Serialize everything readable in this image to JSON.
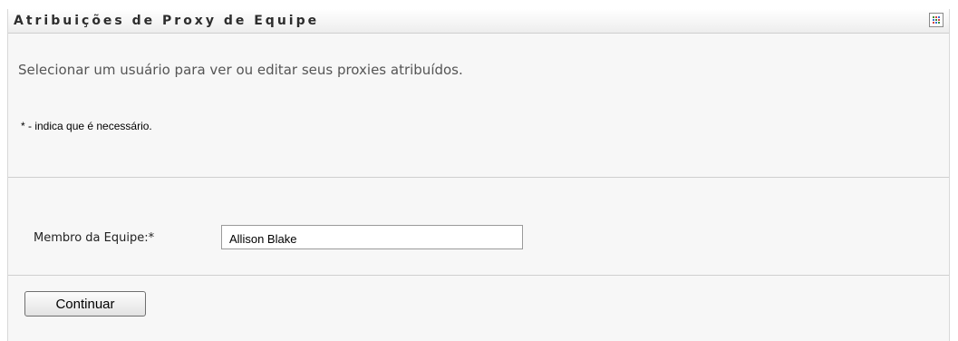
{
  "portlet": {
    "title": "Atribuições de Proxy de Equipe",
    "menu_icon": "grid-menu-icon",
    "description": "Selecionar um usuário para ver ou editar seus proxies atribuídos.",
    "required_note": "* - indica que é necessário."
  },
  "form": {
    "team_member_label": "Membro da Equipe:*",
    "team_member_value": "Allison Blake",
    "continue_label": "Continuar"
  },
  "colors": {
    "panel_background": "#f7f7f7",
    "title_text": "#2d2d2d",
    "divider": "#cfcfcf"
  }
}
